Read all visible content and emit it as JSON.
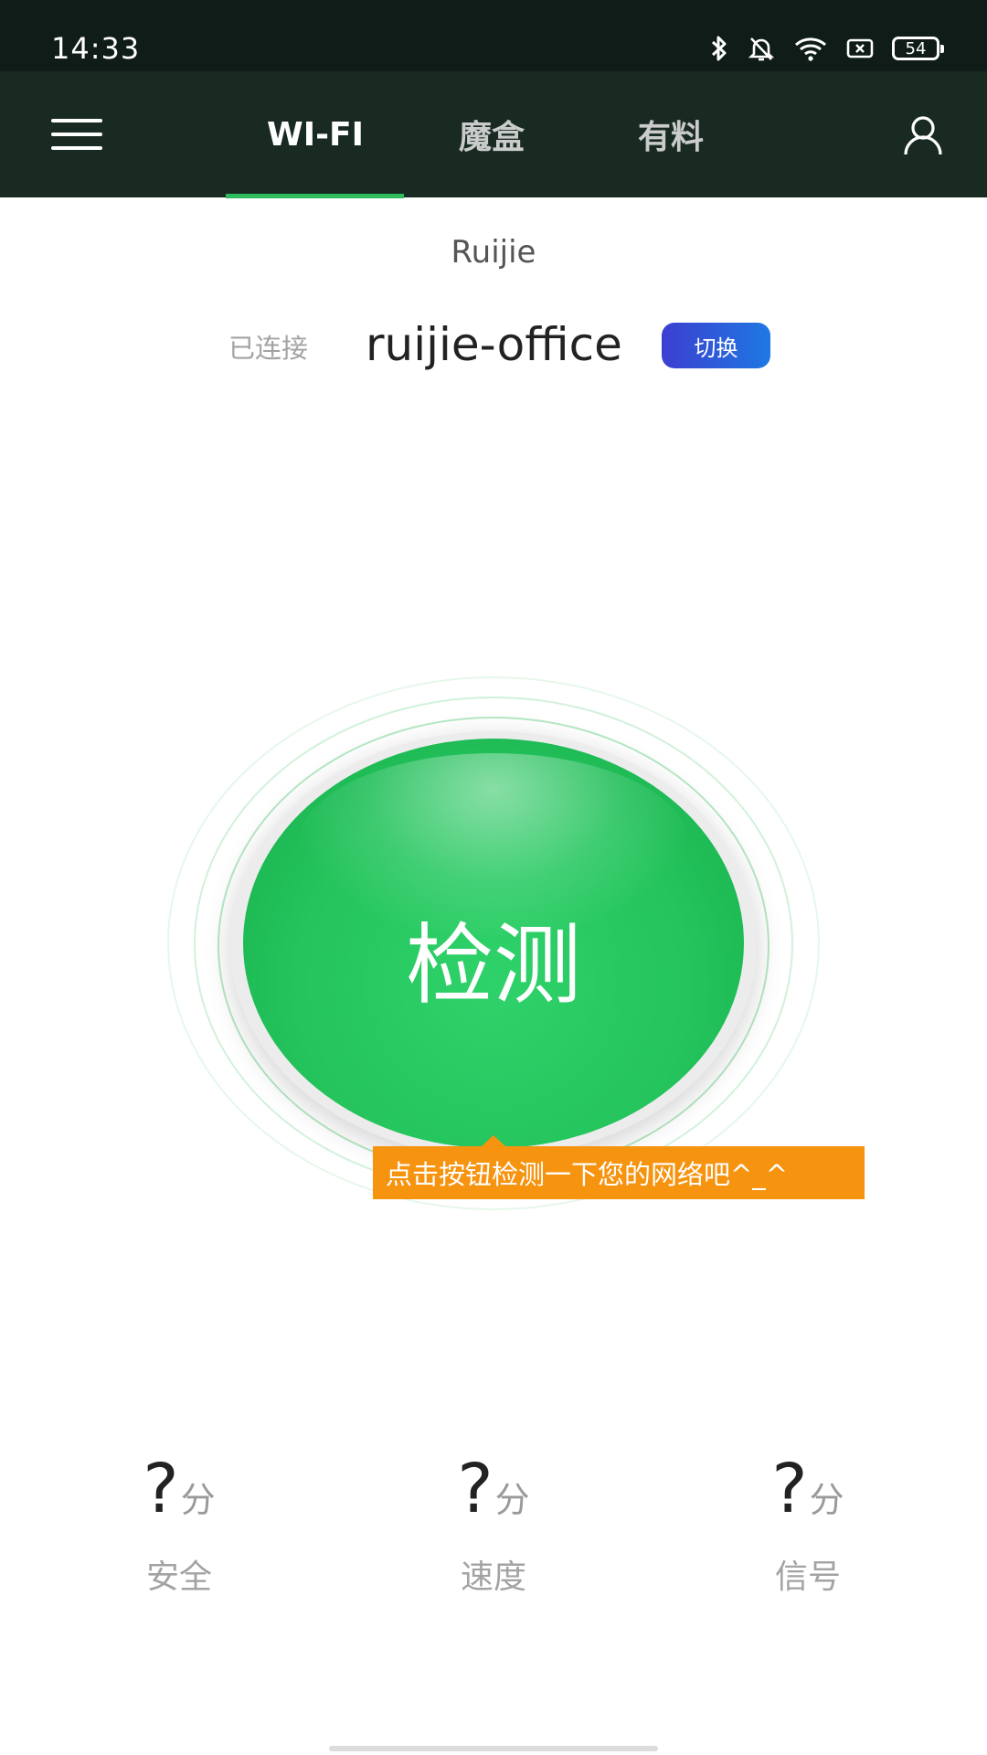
{
  "status_bar": {
    "time": "14:33",
    "battery_level": "54",
    "icons": [
      "bluetooth-icon",
      "mute-bell-icon",
      "wifi-icon",
      "sim-icon",
      "battery-icon"
    ]
  },
  "nav": {
    "tabs": [
      {
        "label": "WI-FI",
        "active": true
      },
      {
        "label": "魔盒",
        "active": false
      },
      {
        "label": "有料",
        "active": false
      }
    ],
    "accent_color": "#2ebc5e"
  },
  "network": {
    "brand": "Ruijie",
    "connected_label": "已连接",
    "ssid": "ruijie-office",
    "switch_label": "切换"
  },
  "detect": {
    "button_label": "检测",
    "hint": "点击按钮检测一下您的网络吧^_^"
  },
  "scores": [
    {
      "value": "?",
      "unit": "分",
      "label": "安全"
    },
    {
      "value": "?",
      "unit": "分",
      "label": "速度"
    },
    {
      "value": "?",
      "unit": "分",
      "label": "信号"
    }
  ]
}
